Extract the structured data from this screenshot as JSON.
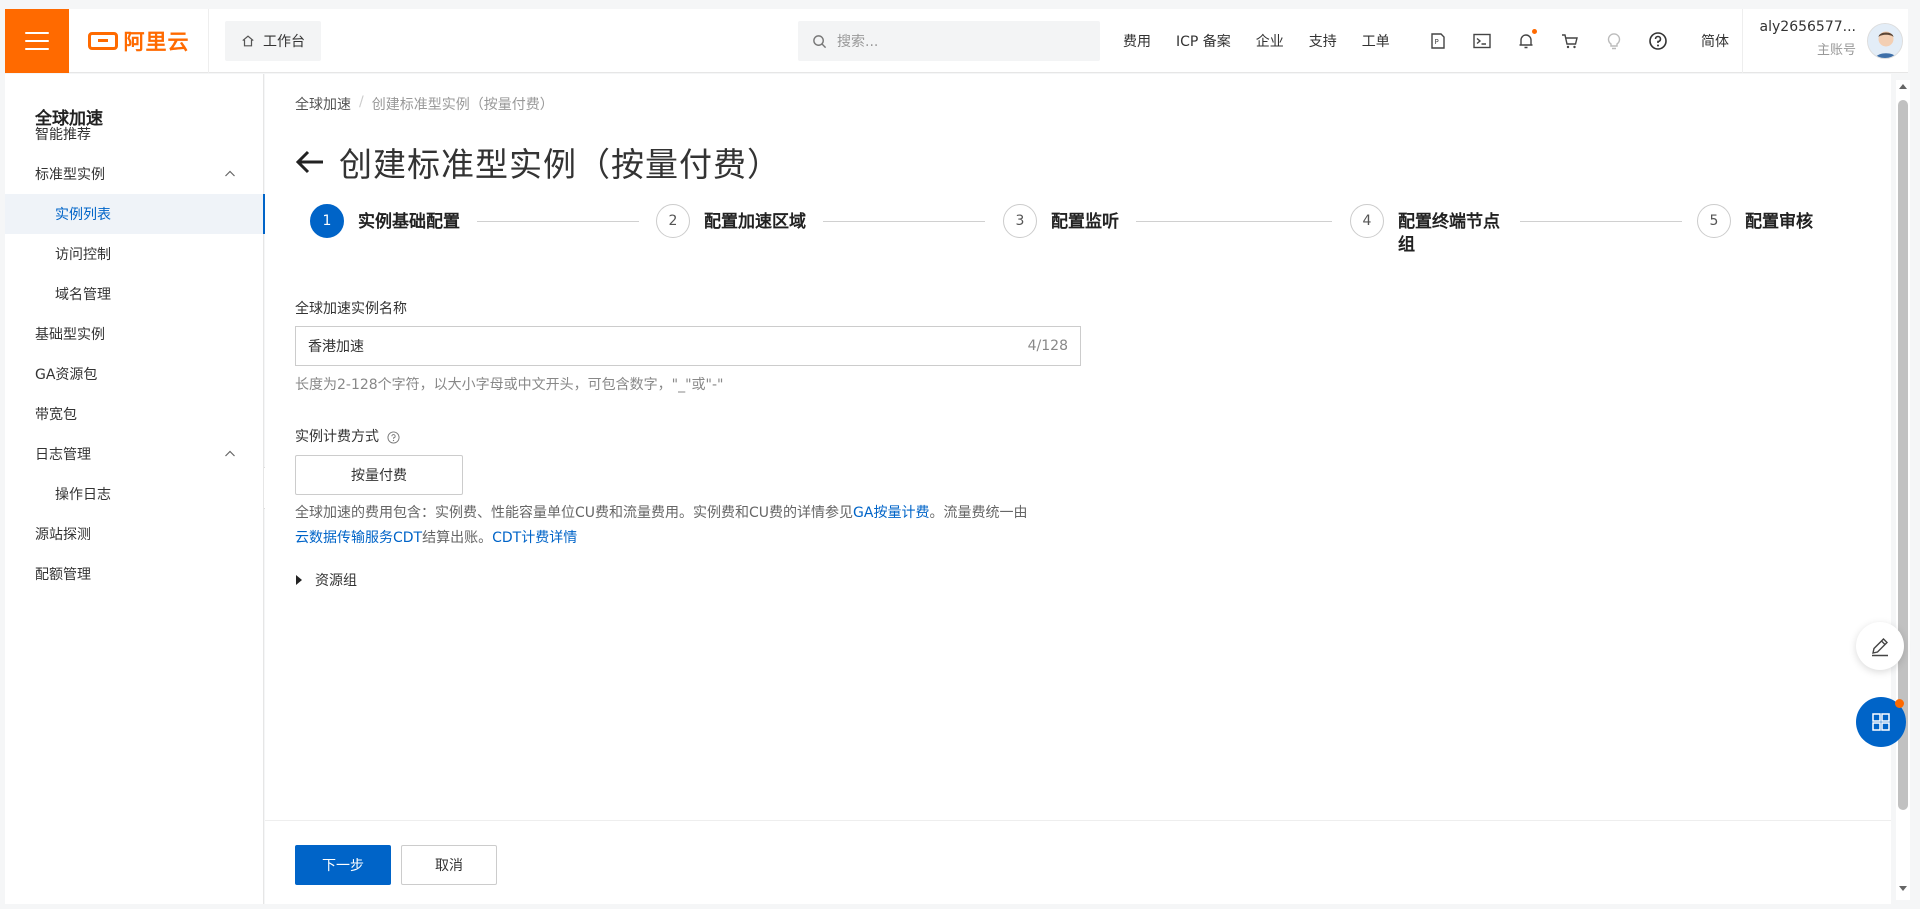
{
  "brand": {
    "logo_text": "阿里云",
    "accent_color": "#ff6a00",
    "primary_color": "#0064c8"
  },
  "topbar": {
    "workbench_label": "工作台",
    "search_placeholder": "搜索...",
    "links": [
      "费用",
      "ICP 备案",
      "企业",
      "支持",
      "工单"
    ],
    "icons": [
      "api-icon",
      "terminal-icon",
      "bell-icon",
      "cart-icon",
      "bulb-icon",
      "help-icon"
    ],
    "language": "简体",
    "user_name": "aly2656577...",
    "user_role": "主账号"
  },
  "sidebar": {
    "title": "全球加速",
    "items": [
      {
        "label": "智能推荐",
        "level": 1
      },
      {
        "label": "标准型实例",
        "level": 1,
        "expanded": true
      },
      {
        "label": "实例列表",
        "level": 2,
        "active": true
      },
      {
        "label": "访问控制",
        "level": 2
      },
      {
        "label": "域名管理",
        "level": 2
      },
      {
        "label": "基础型实例",
        "level": 1
      },
      {
        "label": "GA资源包",
        "level": 1
      },
      {
        "label": "带宽包",
        "level": 1
      },
      {
        "label": "日志管理",
        "level": 1,
        "expanded": true
      },
      {
        "label": "操作日志",
        "level": 2
      },
      {
        "label": "源站探测",
        "level": 1
      },
      {
        "label": "配额管理",
        "level": 1
      }
    ]
  },
  "breadcrumb": {
    "root": "全球加速",
    "separator": "/",
    "current": "创建标准型实例（按量付费）"
  },
  "page_title": "创建标准型实例（按量付费）",
  "steps": [
    {
      "num": "1",
      "label": "实例基础配置",
      "active": true
    },
    {
      "num": "2",
      "label": "配置加速区域"
    },
    {
      "num": "3",
      "label": "配置监听"
    },
    {
      "num": "4",
      "label": "配置终端节点组"
    },
    {
      "num": "5",
      "label": "配置审核"
    }
  ],
  "form": {
    "name_label": "全球加速实例名称",
    "name_value": "香港加速",
    "name_counter": "4/128",
    "name_hint": "长度为2-128个字符，以大小字母或中文开头，可包含数字，\"_\"或\"-\"",
    "billing_label": "实例计费方式",
    "billing_value": "按量付费",
    "billing_desc_1": "全球加速的费用包含：实例费、性能容量单位CU费和流量费用。实例费和CU费的详情参见",
    "billing_link_1": "GA按量计费",
    "billing_desc_2": "。流量费统一由",
    "billing_link_2": "云数据传输服务CDT",
    "billing_desc_3": "结算出账。",
    "billing_link_3": "CDT计费详情",
    "resource_group_label": "资源组"
  },
  "footer": {
    "next_label": "下一步",
    "cancel_label": "取消"
  }
}
